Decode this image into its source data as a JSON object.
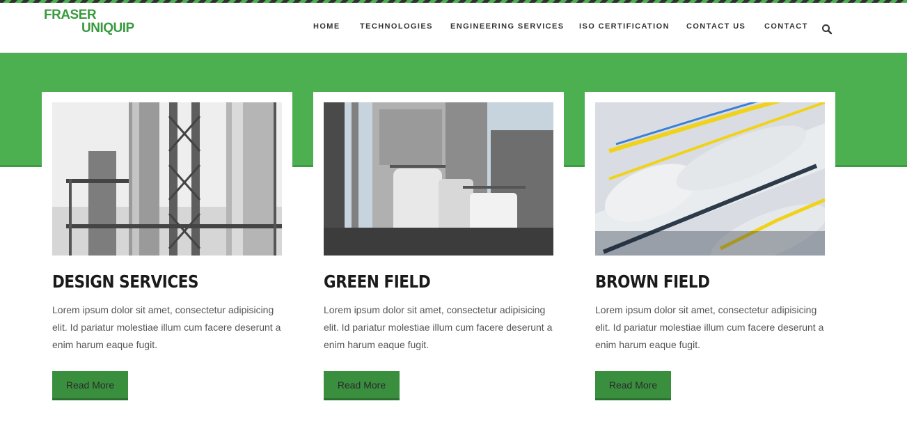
{
  "brand": {
    "line1": "FRASER",
    "line2": "UNIQUIP"
  },
  "nav": {
    "items": [
      {
        "label": "HOME"
      },
      {
        "label": "TECHNOLOGIES"
      },
      {
        "label": "ENGINEERING SERVICES"
      },
      {
        "label": "ISO CERTIFICATION"
      },
      {
        "label": "CONTACT US"
      },
      {
        "label": "CONTACT"
      }
    ],
    "search_icon": "search-icon"
  },
  "colors": {
    "accent": "#4caf50",
    "button": "#3a8f3f",
    "title": "#1a1a1a",
    "body_text": "#555555"
  },
  "cards": [
    {
      "title": "DESIGN SERVICES",
      "text": "Lorem ipsum dolor sit amet, consectetur adipisicing elit. Id pariatur molestiae illum cum facere deserunt a enim harum eaque fugit.",
      "button": "Read More"
    },
    {
      "title": "GREEN FIELD",
      "text": "Lorem ipsum dolor sit amet, consectetur adipisicing elit. Id pariatur molestiae illum cum facere deserunt a enim harum eaque fugit.",
      "button": "Read More"
    },
    {
      "title": "BROWN FIELD",
      "text": "Lorem ipsum dolor sit amet, consectetur adipisicing elit. Id pariatur molestiae illum cum facere deserunt a enim harum eaque fugit.",
      "button": "Read More"
    }
  ]
}
